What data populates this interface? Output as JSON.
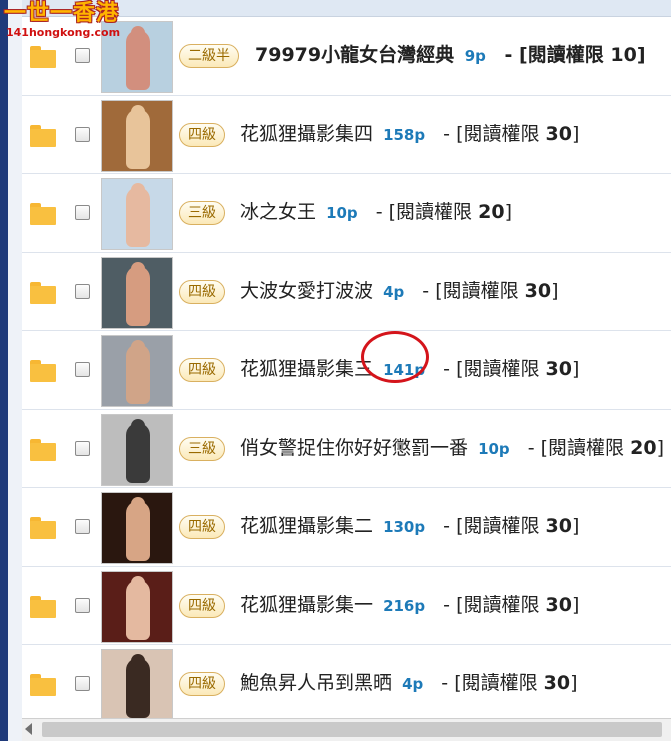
{
  "logo": {
    "text_cn": "一世一香港",
    "text_en": "141hongkong.com"
  },
  "rows": [
    {
      "badge": "二級半",
      "title": "79979小龍女台灣經典",
      "pages": "9p",
      "perm_label": "閱讀權限",
      "perm_value": "10",
      "thumb_color": "#e8b8a8",
      "fig_color": "#d28f7e",
      "bg": "#b8d0e0"
    },
    {
      "badge": "四級",
      "title": "花狐狸攝影集四",
      "pages": "158p",
      "perm_label": "閱讀權限",
      "perm_value": "30",
      "thumb_color": "#c89060",
      "fig_color": "#e8c49a",
      "bg": "#a06a3a"
    },
    {
      "badge": "三級",
      "title": "冰之女王",
      "pages": "10p",
      "perm_label": "閱讀權限",
      "perm_value": "20",
      "thumb_color": "#d8e6f0",
      "fig_color": "#e6b9a0",
      "bg": "#c7d9e8"
    },
    {
      "badge": "四級",
      "title": "大波女愛打波波",
      "pages": "4p",
      "perm_label": "閱讀權限",
      "perm_value": "30",
      "thumb_color": "#60707a",
      "fig_color": "#d69c80",
      "bg": "#4f5d64"
    },
    {
      "badge": "四級",
      "title": "花狐狸攝影集三",
      "pages": "141p",
      "perm_label": "閱讀權限",
      "perm_value": "30",
      "thumb_color": "#c0c4c8",
      "fig_color": "#d0a488",
      "bg": "#9aa0a8"
    },
    {
      "badge": "三級",
      "title": "俏女警捉住你好好懲罰一番",
      "pages": "10p",
      "perm_label": "閱讀權限",
      "perm_value": "20",
      "thumb_color": "#a8a8a8",
      "fig_color": "#3a3a3a",
      "bg": "#bdbdbd"
    },
    {
      "badge": "四級",
      "title": "花狐狸攝影集二",
      "pages": "130p",
      "perm_label": "閱讀權限",
      "perm_value": "30",
      "thumb_color": "#3a2418",
      "fig_color": "#d7a585",
      "bg": "#2a170f"
    },
    {
      "badge": "四級",
      "title": "花狐狸攝影集一",
      "pages": "216p",
      "perm_label": "閱讀權限",
      "perm_value": "30",
      "thumb_color": "#7a3028",
      "fig_color": "#e4b9a0",
      "bg": "#5a1e18"
    },
    {
      "badge": "四級",
      "title": "鮑魚昇人吊到黑晒",
      "pages": "4p",
      "perm_label": "閱讀權限",
      "perm_value": "30",
      "thumb_color": "#e8d8cc",
      "fig_color": "#3a2a22",
      "bg": "#d9c4b4"
    }
  ]
}
